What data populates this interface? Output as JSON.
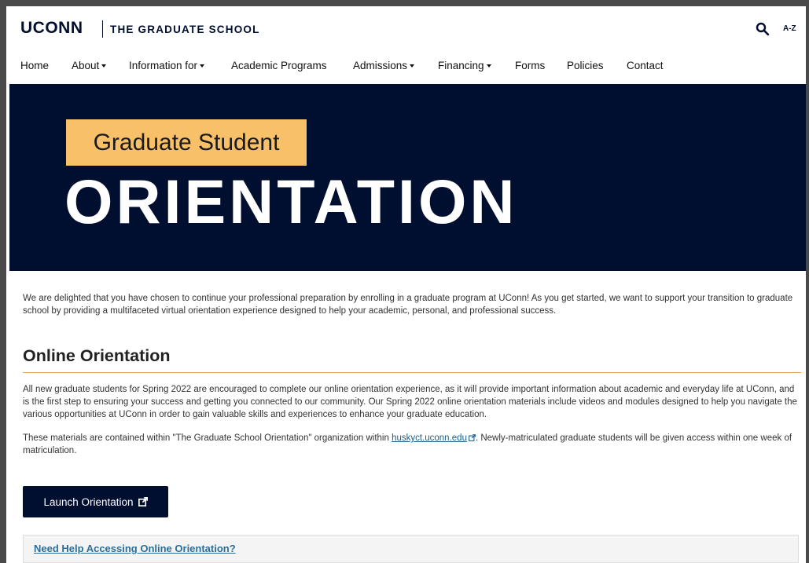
{
  "header": {
    "logo": "UCONN",
    "school": "THE GRADUATE SCHOOL",
    "search_icon": "search-icon",
    "az_label": "A-Z"
  },
  "nav": {
    "items": [
      {
        "label": "Home",
        "dropdown": false
      },
      {
        "label": "About",
        "dropdown": true
      },
      {
        "label": "Information for",
        "dropdown": true
      },
      {
        "label": "Academic Programs",
        "dropdown": false
      },
      {
        "label": "Admissions",
        "dropdown": true
      },
      {
        "label": "Financing",
        "dropdown": true
      },
      {
        "label": "Forms",
        "dropdown": false
      },
      {
        "label": "Policies",
        "dropdown": false
      },
      {
        "label": "Contact",
        "dropdown": false
      }
    ]
  },
  "hero": {
    "tag": "Graduate Student",
    "title": "ORIENTATION"
  },
  "intro": "We are delighted that you have chosen to continue your professional preparation by enrolling in a graduate program at UConn! As you get started, we want to support your transition to graduate school by providing a multifaceted virtual orientation experience designed to help your academic, personal, and professional success.",
  "section": {
    "title": "Online Orientation",
    "p1": "All new graduate students for Spring 2022 are encouraged to complete our online orientation experience, as it will provide important information about academic and everyday life at UConn, and is the first step to ensuring your success and getting you connected to our community. Our Spring 2022 online orientation materials include videos and modules designed to help you navigate the various opportunities at UConn in order to gain valuable skills and experiences to enhance your graduate education.",
    "p2_before": "These materials are contained within \"The Graduate School Orientation\" organization within ",
    "p2_link": "huskyct.uconn.edu",
    "p2_after": ". Newly-matriculated graduate students will be given access within one week of matriculation."
  },
  "launch_button": "Launch Orientation",
  "help_link": "Need Help Accessing Online Orientation?",
  "colors": {
    "navy": "#000e2f",
    "gold": "#f8c069",
    "rule": "#d9a650",
    "link": "#1a5e8a"
  }
}
